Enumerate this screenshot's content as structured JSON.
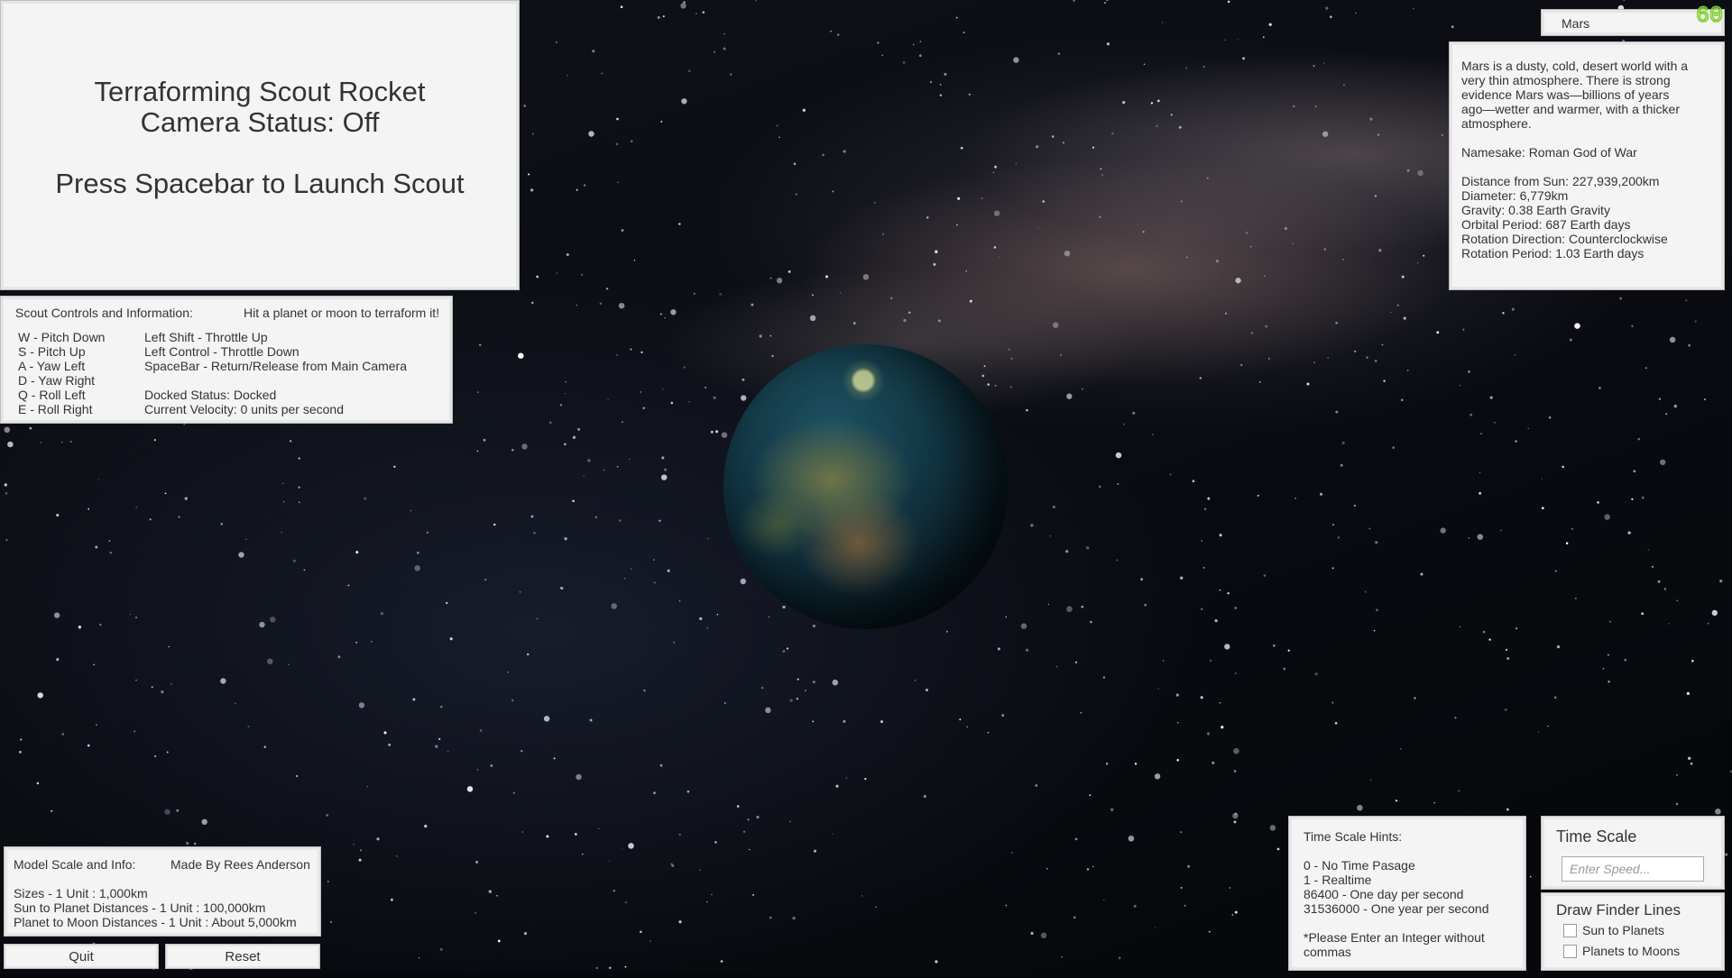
{
  "status_panel": {
    "title_line1": "Terraforming Scout Rocket",
    "title_line2": "Camera Status: Off",
    "launch_prompt": "Press Spacebar to Launch Scout"
  },
  "controls_panel": {
    "heading": "Scout Controls and Information:",
    "hint": "Hit a planet or moon to terraform it!",
    "keys_left": [
      "W - Pitch Down",
      "S - Pitch Up",
      "A - Yaw Left",
      "D - Yaw Right",
      "Q - Roll Left",
      "E - Roll Right"
    ],
    "keys_right": [
      "Left Shift - Throttle Up",
      "Left Control - Throttle Down",
      "SpaceBar - Return/Release from Main Camera"
    ],
    "docked_status": "Docked Status: Docked",
    "velocity": "Current Velocity: 0 units per second"
  },
  "planet_tab": {
    "name": "Mars"
  },
  "fps": {
    "value": "60",
    "color": "#7ccf2a"
  },
  "info_panel": {
    "description": [
      "Mars is a dusty, cold, desert world with a",
      "very thin atmosphere. There is strong",
      "evidence Mars was—billions of years",
      "ago—wetter and warmer, with a thicker",
      "atmosphere."
    ],
    "namesake": "Namesake: Roman God of War",
    "stats": [
      "Distance from Sun: 227,939,200km",
      "Diameter: 6,779km",
      "Gravity: 0.38 Earth Gravity",
      "Orbital Period: 687 Earth days",
      "Rotation Direction: Counterclockwise",
      "Rotation Period: 1.03 Earth days"
    ]
  },
  "model_panel": {
    "heading": "Model Scale and Info:",
    "author": "Made By Rees Anderson",
    "lines": [
      "Sizes - 1 Unit : 1,000km",
      "Sun to Planet Distances - 1 Unit : 100,000km",
      "Planet to Moon Distances - 1 Unit : About 5,000km"
    ]
  },
  "buttons": {
    "quit": "Quit",
    "reset": "Reset"
  },
  "hints_panel": {
    "heading": "Time Scale Hints:",
    "lines": [
      "0 - No Time Pasage",
      "1 - Realtime",
      "86400 - One day per second",
      "31536000 - One year per second"
    ],
    "note": [
      "*Please Enter an Integer without",
      "commas"
    ]
  },
  "timescale_panel": {
    "heading": "Time Scale",
    "placeholder": "Enter Speed...",
    "value": ""
  },
  "finder_panel": {
    "heading": "Draw Finder Lines",
    "options": [
      {
        "label": "Sun to Planets",
        "checked": false
      },
      {
        "label": "Planets to Moons",
        "checked": false
      }
    ]
  }
}
